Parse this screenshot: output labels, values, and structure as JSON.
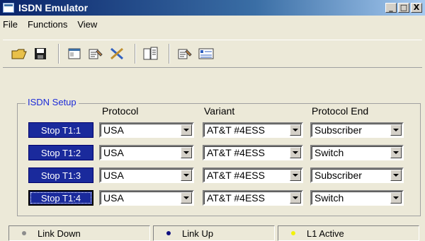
{
  "window": {
    "title": "ISDN Emulator"
  },
  "window_buttons": [
    "_",
    "□",
    "X"
  ],
  "menu": [
    {
      "label": "File"
    },
    {
      "label": "Functions"
    },
    {
      "label": "View"
    }
  ],
  "toolbar_icons": [
    "open-folder-icon",
    "save-icon",
    "window-icon",
    "properties-icon",
    "tools-icon",
    "document-icon",
    "properties-2-icon",
    "list-icon"
  ],
  "setup": {
    "legend": "ISDN Setup",
    "headers": {
      "protocol": "Protocol",
      "variant": "Variant",
      "protocol_end": "Protocol End"
    },
    "rows": [
      {
        "button": "Stop T1:1",
        "protocol": "USA",
        "variant": "AT&T #4ESS",
        "protocol_end": "Subscriber"
      },
      {
        "button": "Stop T1:2",
        "protocol": "USA",
        "variant": "AT&T #4ESS",
        "protocol_end": "Switch"
      },
      {
        "button": "Stop T1:3",
        "protocol": "USA",
        "variant": "AT&T #4ESS",
        "protocol_end": "Subscriber"
      },
      {
        "button": "Stop T1:4",
        "protocol": "USA",
        "variant": "AT&T #4ESS",
        "protocol_end": "Switch"
      }
    ]
  },
  "status": [
    {
      "label": "Link Down",
      "color": "#8c8c8c"
    },
    {
      "label": "Link Up",
      "color": "#101080"
    },
    {
      "label": "L1 Active",
      "color": "#f2f20a"
    }
  ]
}
